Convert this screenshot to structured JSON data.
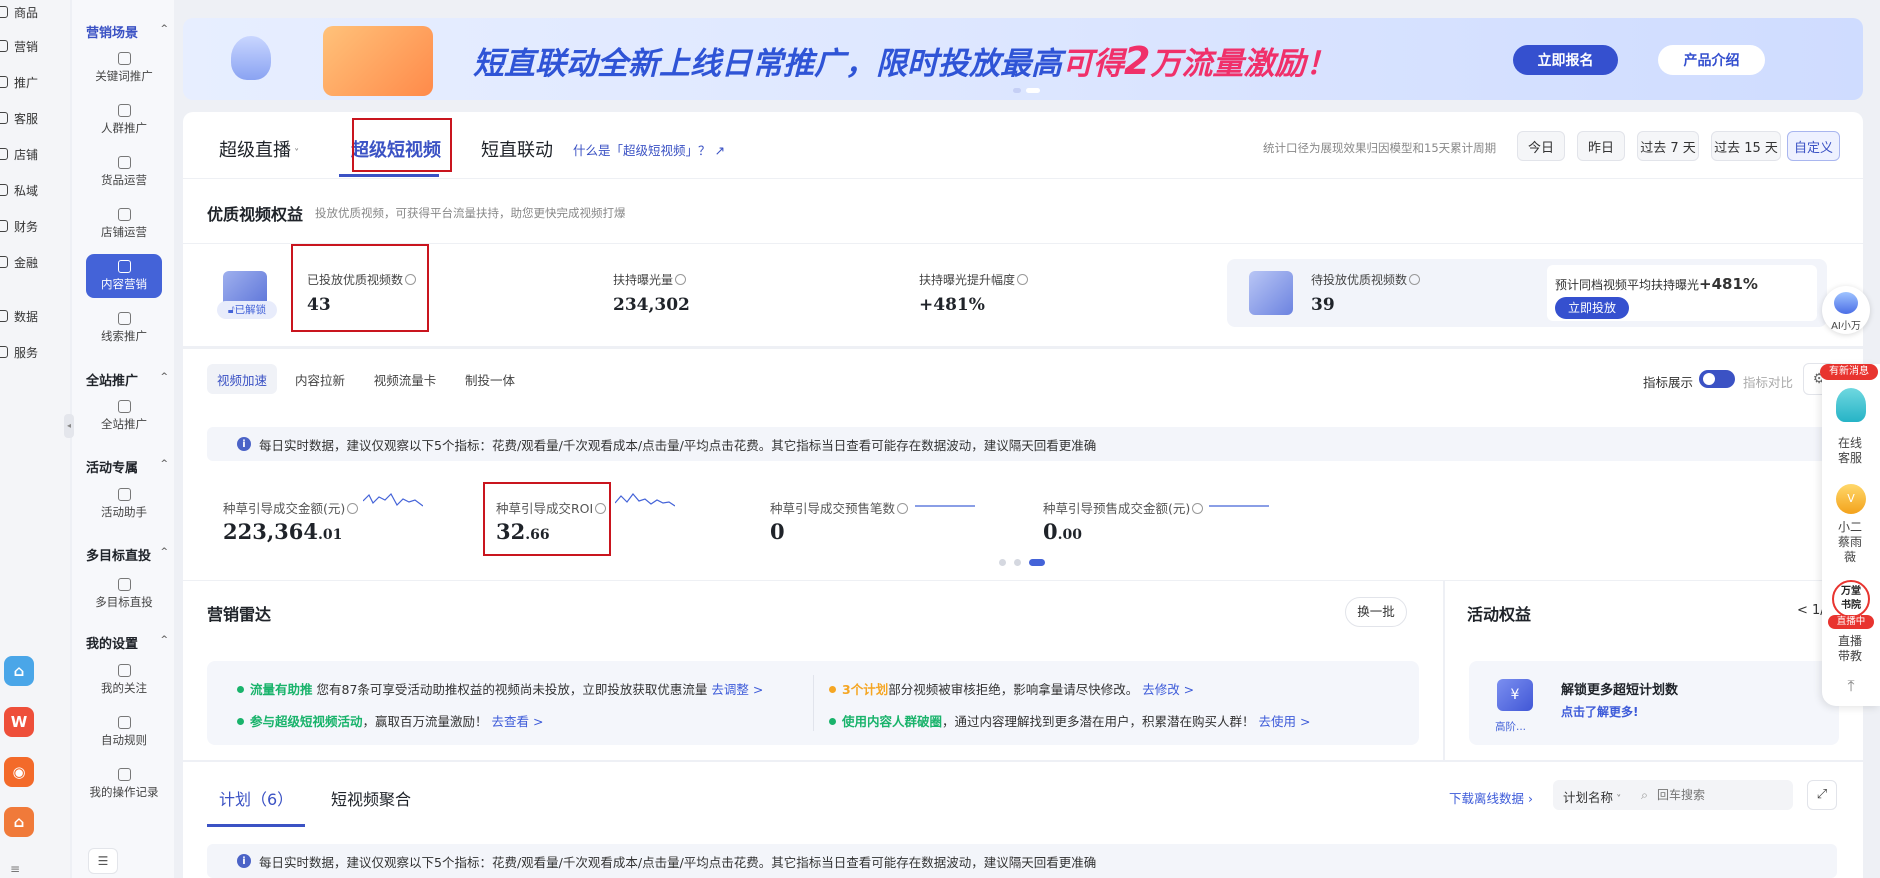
{
  "rail": {
    "items": [
      "商品",
      "营销",
      "推广",
      "客服",
      "店铺",
      "私域",
      "财务",
      "金融",
      "数据",
      "服务"
    ]
  },
  "sidebar": {
    "sections": [
      {
        "title": "营销场景",
        "items": [
          "关键词推广",
          "人群推广",
          "货品运营",
          "店铺运营",
          "内容营销",
          "线索推广"
        ]
      },
      {
        "title": "全站推广",
        "items": [
          "全站推广"
        ]
      },
      {
        "title": "活动专属",
        "items": [
          "活动助手"
        ]
      },
      {
        "title": "多目标直投",
        "items": [
          "多目标直投"
        ]
      },
      {
        "title": "我的设置",
        "items": [
          "我的关注",
          "自动规则",
          "我的操作记录"
        ]
      }
    ],
    "active_item": "内容营销"
  },
  "banner": {
    "text_main": "短直联动全新上线日常推广，限时投放最高",
    "text_highlight": "可得",
    "text_num": "2",
    "text_tail": "万流量激励！",
    "btn_signup": "立即报名",
    "btn_intro": "产品介绍"
  },
  "top_tabs": {
    "tab1": "超级直播",
    "tab2": "超级短视频",
    "tab3": "短直联动",
    "help_link": "什么是「超级短视频」？",
    "stat_note": "统计口径为展现效果归因模型和15天累计周期",
    "dates": [
      "今日",
      "昨日",
      "过去 7 天",
      "过去 15 天",
      "自定义"
    ],
    "active_date": "自定义"
  },
  "quality": {
    "title": "优质视频权益",
    "subtitle": "投放优质视频，可获得平台流量扶持，助您更快完成视频打爆",
    "unlocked": "已解锁",
    "m1_label": "已投放优质视频数",
    "m1_value": "43",
    "m2_label": "扶持曝光量",
    "m2_value": "234,302",
    "m3_label": "扶持曝光提升幅度",
    "m3_value": "+481%",
    "m4_label": "待投放优质视频数",
    "m4_value": "39",
    "promo_text": "预计同档视频平均扶持曝光",
    "promo_value": "+481%",
    "promo_btn": "立即投放"
  },
  "subtabs": {
    "tabs": [
      "视频加速",
      "内容拉新",
      "视频流量卡",
      "制投一体"
    ],
    "active": "视频加速",
    "metric_display": "指标展示",
    "metric_compare": "指标对比"
  },
  "notice": "每日实时数据，建议仅观察以下5个指标：花费/观看量/千次观看成本/点击量/平均点击花费。其它指标当日查看可能存在数据波动，建议隔天回看更准确",
  "kpis": [
    {
      "label": "种草引导成交金额(元)",
      "int": "223,364",
      "dec": ".01"
    },
    {
      "label": "种草引导成交ROI",
      "int": "32",
      "dec": ".66"
    },
    {
      "label": "种草引导成交预售笔数",
      "int": "0",
      "dec": ""
    },
    {
      "label": "种草引导预售成交金额(元)",
      "int": "0",
      "dec": ".00"
    }
  ],
  "radar": {
    "title": "营销雷达",
    "refresh": "换一批",
    "r1_tag": "流量有助推",
    "r1_text": "您有87条可享受活动助推权益的视频尚未投放，立即投放获取优惠流量",
    "r1_link": "去调整 >",
    "r2_tag": "参与超级短视频活动",
    "r2_text": "，赢取百万流量激励！",
    "r2_link": "去查看 >",
    "r3_tag": "3个计划",
    "r3_text": "部分视频被审核拒绝，影响拿量请尽快修改。",
    "r3_link": "去修改 >",
    "r4_tag": "使用内容人群破圈",
    "r4_text": "，通过内容理解找到更多潜在用户，积累潜在购买人群！",
    "r4_link": "去使用 >",
    "colors": {
      "green": "#19b36b",
      "orange": "#f5a623",
      "link": "#3d5bd9"
    }
  },
  "benefit": {
    "title": "活动权益",
    "pager": "< 1/",
    "item_title": "解锁更多超短计划数",
    "item_link": "点击了解更多!",
    "item_tag": "高阶..."
  },
  "plans": {
    "tab1": "计划（6）",
    "tab2": "短视频聚合",
    "download": "下载离线数据",
    "filter": "计划名称",
    "search_placeholder": "回车搜索"
  },
  "float": {
    "ai": "AI小万",
    "new_msg": "有新消息",
    "online": "在线客服",
    "xiaoer": "小二蔡雨薇",
    "school": "万堂书院",
    "live_badge": "直播中",
    "live": "直播带教"
  },
  "accent": "#4463d8"
}
